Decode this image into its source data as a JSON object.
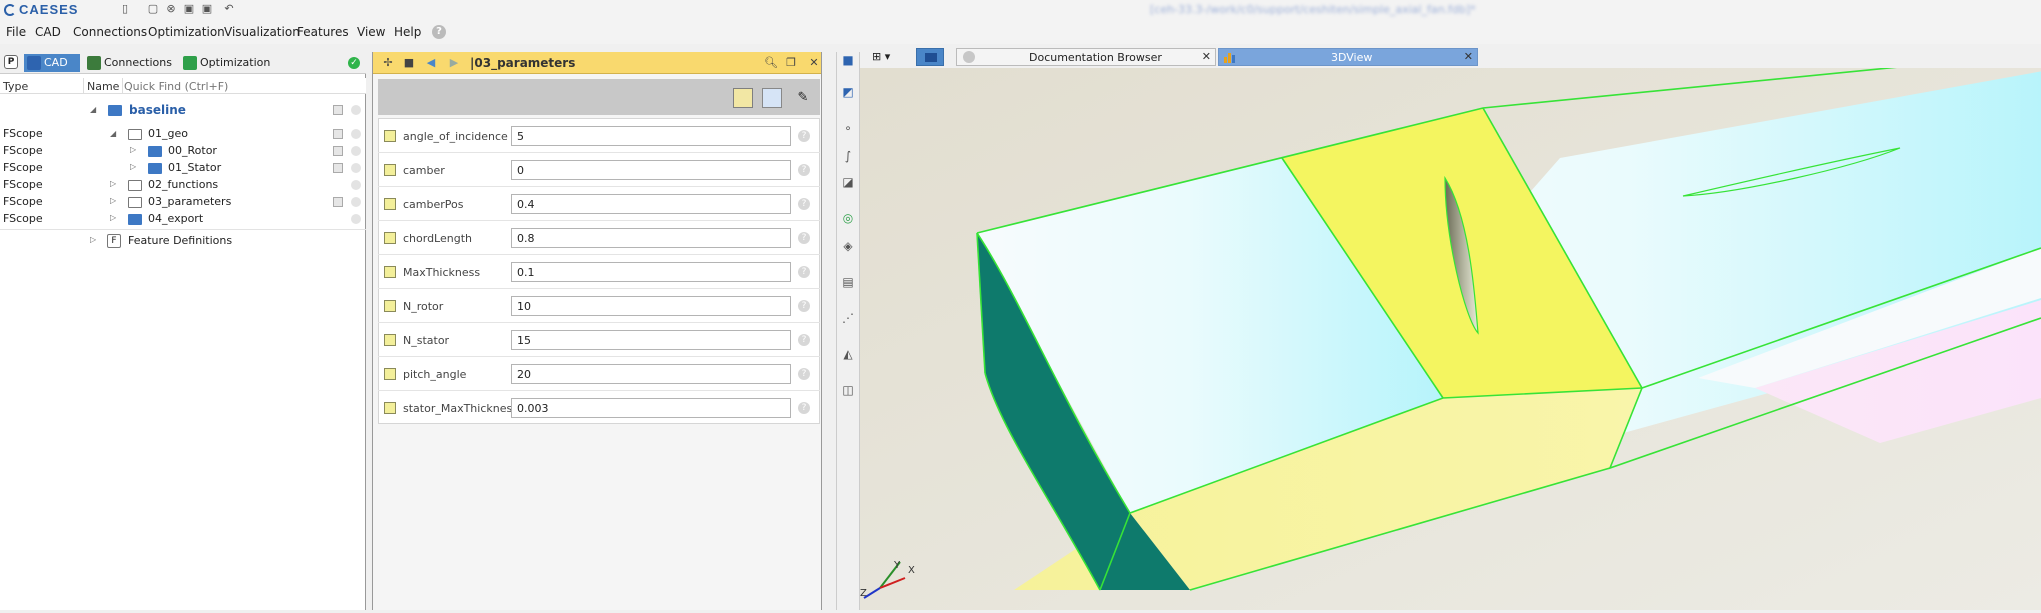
{
  "app": {
    "logo": "CAESES",
    "title_path": "[ceh-33.3-/work/c0/support/ceshiten/simple_axial_fan.fdb]*"
  },
  "menu": [
    "File",
    "CAD",
    "Connections",
    "Optimization",
    "Visualization",
    "Features",
    "View",
    "Help"
  ],
  "help_button": "?",
  "left_panel": {
    "p_tab": "P",
    "tabs": [
      "CAD",
      "Connections",
      "Optimization"
    ],
    "columns": {
      "type": "Type",
      "name": "Name",
      "find": "Quick Find (Ctrl+F)"
    },
    "tree": {
      "root": "baseline",
      "rows": [
        {
          "type": "FScope",
          "name": "01_geo"
        },
        {
          "type": "FScope",
          "name": "00_Rotor"
        },
        {
          "type": "FScope",
          "name": "01_Stator"
        },
        {
          "type": "FScope",
          "name": "02_functions"
        },
        {
          "type": "FScope",
          "name": "03_parameters"
        },
        {
          "type": "FScope",
          "name": "04_export"
        }
      ],
      "feature_definitions": "Feature Definitions",
      "feature_icon": "F"
    }
  },
  "params_panel": {
    "title": "|03_parameters",
    "params": [
      {
        "name": "angle_of_incidence",
        "value": "5"
      },
      {
        "name": "camber",
        "value": "0"
      },
      {
        "name": "camberPos",
        "value": "0.4"
      },
      {
        "name": "chordLength",
        "value": "0.8"
      },
      {
        "name": "MaxThickness",
        "value": "0.1"
      },
      {
        "name": "N_rotor",
        "value": "10"
      },
      {
        "name": "N_stator",
        "value": "15"
      },
      {
        "name": "pitch_angle",
        "value": "20"
      },
      {
        "name": "stator_MaxThickness",
        "value": "0.003"
      }
    ]
  },
  "view": {
    "tabs": [
      "Documentation Browser",
      "3DView"
    ],
    "axes": {
      "x": "X",
      "y": "Y",
      "z": "Z"
    }
  },
  "colors": {
    "accent": "#4a86c8",
    "header_yellow": "#f9d96e",
    "yellow_face": "#f4f560",
    "teal_face": "#0e7a6c",
    "edge_green": "#37e337"
  }
}
